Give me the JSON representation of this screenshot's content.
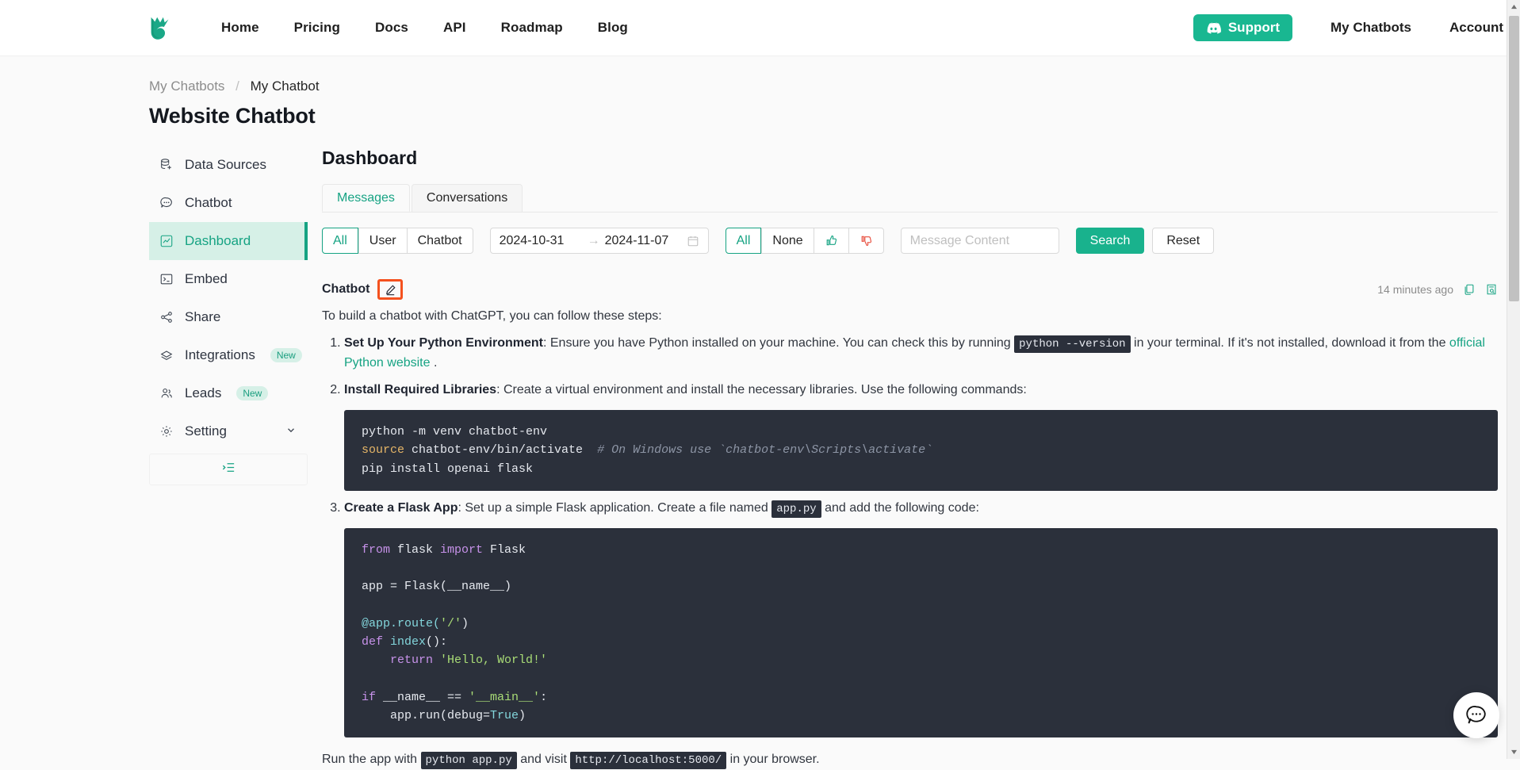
{
  "header": {
    "logo_name": "chatbot-logo",
    "nav": [
      {
        "label": "Home"
      },
      {
        "label": "Pricing"
      },
      {
        "label": "Docs"
      },
      {
        "label": "API"
      },
      {
        "label": "Roadmap"
      },
      {
        "label": "Blog"
      }
    ],
    "support_label": "Support",
    "my_chatbots_label": "My Chatbots",
    "account_label": "Account",
    "accent_color": "#19b791"
  },
  "breadcrumb": {
    "parent": "My Chatbots",
    "separator": "/",
    "current": "My Chatbot"
  },
  "page_title": "Website Chatbot",
  "sidebar": {
    "items": [
      {
        "label": "Data Sources",
        "icon": "database-add-icon",
        "active": false,
        "badge": ""
      },
      {
        "label": "Chatbot",
        "icon": "chat-dots-icon",
        "active": false,
        "badge": ""
      },
      {
        "label": "Dashboard",
        "icon": "line-chart-icon",
        "active": true,
        "badge": ""
      },
      {
        "label": "Embed",
        "icon": "code-terminal-icon",
        "active": false,
        "badge": ""
      },
      {
        "label": "Share",
        "icon": "share-nodes-icon",
        "active": false,
        "badge": ""
      },
      {
        "label": "Integrations",
        "icon": "layers-icon",
        "active": false,
        "badge": "New"
      },
      {
        "label": "Leads",
        "icon": "users-icon",
        "active": false,
        "badge": "New"
      },
      {
        "label": "Setting",
        "icon": "gear-icon",
        "active": false,
        "badge": "",
        "chevron": true
      }
    ],
    "collapse_icon": "menu-indent-icon"
  },
  "main": {
    "title": "Dashboard",
    "tabs": [
      {
        "label": "Messages",
        "active": true
      },
      {
        "label": "Conversations",
        "active": false
      }
    ],
    "filters": {
      "sender": {
        "options": [
          "All",
          "User",
          "Chatbot"
        ],
        "selected": "All"
      },
      "date_from": "2024-10-31",
      "date_arrow": "→",
      "date_to": "2024-11-07",
      "calendar_icon": "calendar-icon",
      "feedback": {
        "options": [
          "All",
          "None",
          "thumbs-up-icon",
          "thumbs-down-icon"
        ],
        "selected": "All"
      },
      "message_content_value": "",
      "message_content_placeholder": "Message Content",
      "search_label": "Search",
      "reset_label": "Reset"
    },
    "message": {
      "role": "Chatbot",
      "edit_icon": "edit-pencil-icon",
      "timestamp": "14 minutes ago",
      "copy_icon": "copy-icon",
      "inspect_icon": "document-search-icon",
      "intro": "To build a chatbot with ChatGPT, you can follow these steps:",
      "steps": [
        {
          "num": "1.",
          "title": "Set Up Your Python Environment",
          "text_1": ": Ensure you have Python installed on your machine. You can check this by running ",
          "code_1": "python --version",
          "text_2": " in your terminal. If it's not installed, download it from the ",
          "link": "official Python website",
          "text_3": " ."
        },
        {
          "num": "2.",
          "title": "Install Required Libraries",
          "text_1": ": Create a virtual environment and install the necessary libraries. Use the following commands:"
        },
        {
          "num": "3.",
          "title": "Create a Flask App",
          "text_1": ": Set up a simple Flask application. Create a file named ",
          "code_1": "app.py",
          "text_2": " and add the following code:"
        }
      ],
      "code_block_1": {
        "line1_plain": "python -m venv chatbot-env",
        "line2_kw": "source",
        "line2_plain": " chatbot-env/bin/activate",
        "line2_comment": "# On Windows use `chatbot-env\\Scripts\\activate`",
        "line3_plain": "pip install openai flask"
      },
      "code_block_2": {
        "l1_k1": "from",
        "l1_p1": " flask ",
        "l1_k2": "import",
        "l1_p2": " Flask",
        "l3_p": "app = Flask(__name__)",
        "l5_f": "@app.route(",
        "l5_s": "'/'",
        "l5_p": ")",
        "l6_k": "def",
        "l6_f": " index",
        "l6_p": "():",
        "l7_k": "    return",
        "l7_s": " 'Hello, World!'",
        "l9_k": "if",
        "l9_p1": " __name__ == ",
        "l9_s": "'__main__'",
        "l9_p2": ":",
        "l10_p1": "    app.run(debug=",
        "l10_f": "True",
        "l10_p2": ")"
      },
      "run_line": {
        "text_1": "Run the app with ",
        "code_1": "python app.py",
        "text_2": " and visit ",
        "code_2": "http://localhost:5000/",
        "text_3": " in your browser."
      }
    }
  },
  "floating_widget": {
    "icon": "chat-bubble-dots-icon"
  }
}
